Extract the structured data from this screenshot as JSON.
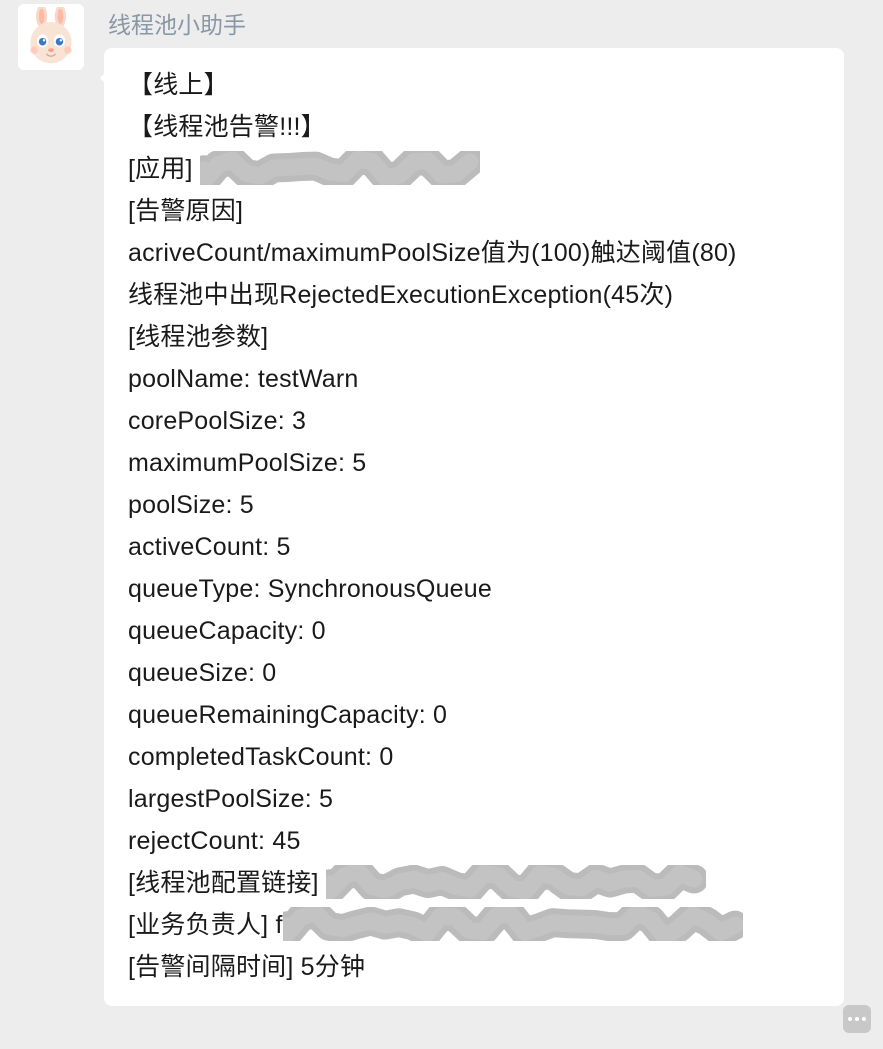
{
  "sender": "线程池小助手",
  "avatar_name": "rabbit-avatar",
  "message": {
    "lines": [
      "【线上】",
      "【线程池告警!!!】",
      "[应用] ",
      "[告警原因]",
      "acriveCount/maximumPoolSize值为(100)触达阈值(80)",
      "线程池中出现RejectedExecutionException(45次)",
      "[线程池参数]",
      "poolName: testWarn",
      "corePoolSize: 3",
      "maximumPoolSize: 5",
      "poolSize: 5",
      "activeCount: 5",
      "queueType: SynchronousQueue",
      "queueCapacity: 0",
      "queueSize: 0",
      "queueRemainingCapacity: 0",
      "completedTaskCount: 0",
      "largestPoolSize: 5",
      "rejectCount: 45",
      "[线程池配置链接] ",
      "[业务负责人] f",
      "[告警间隔时间] 5分钟"
    ],
    "redacted_line_indices": [
      2,
      19,
      20
    ]
  }
}
